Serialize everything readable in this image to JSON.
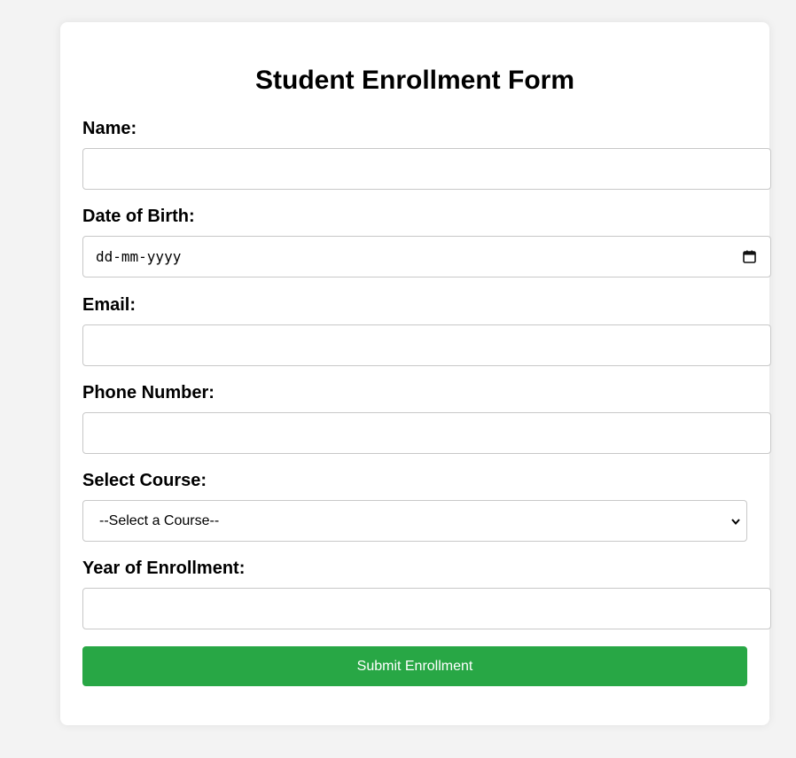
{
  "form": {
    "title": "Student Enrollment Form",
    "fields": [
      {
        "label": "Name:",
        "value": ""
      },
      {
        "label": "Date of Birth:",
        "placeholder": "dd-mm-yyyy"
      },
      {
        "label": "Email:",
        "value": ""
      },
      {
        "label": "Phone Number:",
        "value": ""
      },
      {
        "label": "Select Course:",
        "selected": "--Select a Course--"
      },
      {
        "label": "Year of Enrollment:",
        "value": ""
      }
    ],
    "submit_label": "Submit Enrollment"
  },
  "colors": {
    "page_bg": "#f3f3f3",
    "card_bg": "#ffffff",
    "submit_bg": "#28a745",
    "submit_text": "#ffffff",
    "border": "#c8c8c8"
  },
  "icons": {
    "date": "calendar-icon",
    "select": "chevron-down-icon"
  }
}
